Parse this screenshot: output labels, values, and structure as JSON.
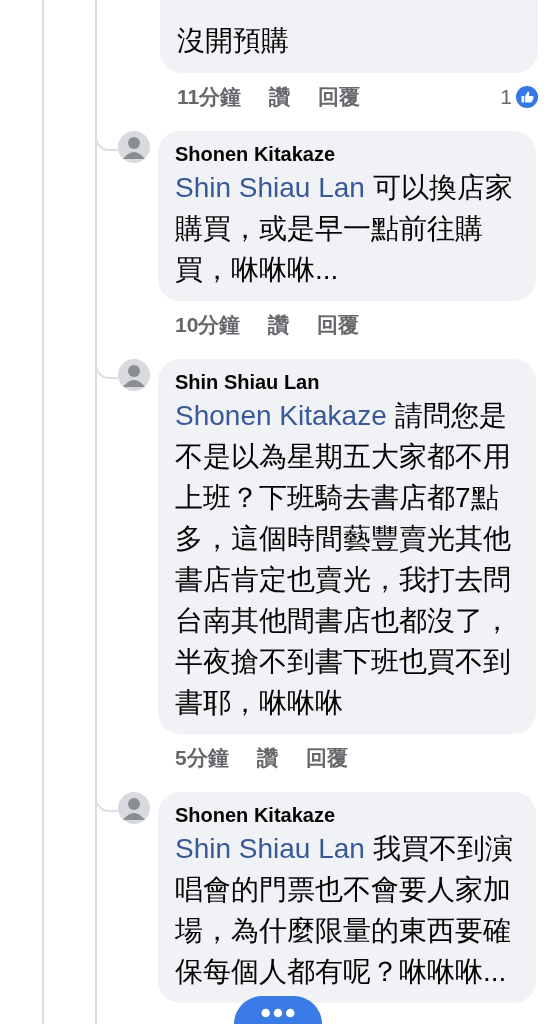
{
  "comments": [
    {
      "kind": "continued",
      "body": "沒開預購",
      "meta": {
        "time": "11分鐘",
        "like": "讚",
        "reply": "回覆",
        "reactions": "1"
      }
    },
    {
      "kind": "full",
      "author": "Shonen Kitakaze",
      "mention": "Shin Shiau Lan",
      "body": "可以換店家購買，或是早一點前往購買，咻咻咻...",
      "meta": {
        "time": "10分鐘",
        "like": "讚",
        "reply": "回覆"
      }
    },
    {
      "kind": "full",
      "author": "Shin Shiau Lan",
      "mention": "Shonen Kitakaze",
      "body": "請問您是不是以為星期五大家都不用上班？下班騎去書店都7點多，這個時間藝豐賣光其他書店肯定也賣光，我打去問台南其他間書店也都沒了，半夜搶不到書下班也買不到書耶，咻咻咻",
      "meta": {
        "time": "5分鐘",
        "like": "讚",
        "reply": "回覆"
      }
    },
    {
      "kind": "full",
      "author": "Shonen Kitakaze",
      "mention": "Shin Shiau Lan",
      "body": "我買不到演唱會的門票也不會要人家加場，為什麼限量的東西要確保每個人都有呢？咻咻咻..."
    }
  ]
}
